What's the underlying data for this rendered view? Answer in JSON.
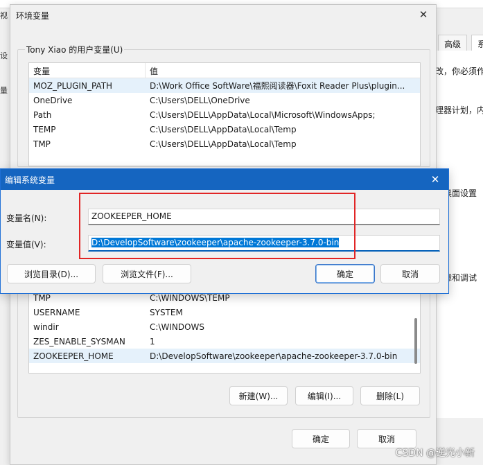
{
  "background": {
    "top_left_fragment": "视",
    "tab_advanced": "高级",
    "tab_next": "系",
    "snippets": [
      "改，你必须作",
      "理器计划，内",
      "的桌面设置",
      "故障和调试"
    ],
    "left_fragments": [
      "设",
      "量"
    ]
  },
  "env_window": {
    "title": "环境变量",
    "user_group_label": "Tony Xiao 的用户变量(U)",
    "columns": [
      "变量",
      "值"
    ],
    "user_vars": [
      {
        "name": "MOZ_PLUGIN_PATH",
        "value": "D:\\Work Office SoftWare\\福熙阅读器\\Foxit Reader Plus\\plugin..."
      },
      {
        "name": "OneDrive",
        "value": "C:\\Users\\DELL\\OneDrive"
      },
      {
        "name": "Path",
        "value": "C:\\Users\\DELL\\AppData\\Local\\Microsoft\\WindowsApps;"
      },
      {
        "name": "TEMP",
        "value": "C:\\Users\\DELL\\AppData\\Local\\Temp"
      },
      {
        "name": "TMP",
        "value": "C:\\Users\\DELL\\AppData\\Local\\Temp"
      }
    ],
    "system_vars": [
      {
        "name": "TMP",
        "value": "C:\\WINDOWS\\TEMP"
      },
      {
        "name": "USERNAME",
        "value": "SYSTEM"
      },
      {
        "name": "windir",
        "value": "C:\\WINDOWS"
      },
      {
        "name": "ZES_ENABLE_SYSMAN",
        "value": "1"
      },
      {
        "name": "ZOOKEEPER_HOME",
        "value": "D:\\DevelopSoftware\\zookeeper\\apache-zookeeper-3.7.0-bin"
      }
    ],
    "new_button": "新建(W)...",
    "edit_button": "编辑(I)...",
    "delete_button": "删除(L)",
    "ok_button": "确定",
    "cancel_button": "取消"
  },
  "edit_dialog": {
    "title": "编辑系统变量",
    "name_label": "变量名(N):",
    "name_value": "ZOOKEEPER_HOME",
    "value_label": "变量值(V):",
    "value_value": "D:\\DevelopSoftware\\zookeeper\\apache-zookeeper-3.7.0-bin",
    "browse_dir_button": "浏览目录(D)...",
    "browse_file_button": "浏览文件(F)...",
    "ok_button": "确定",
    "cancel_button": "取消"
  },
  "watermark": "CSDN @逆光小新"
}
